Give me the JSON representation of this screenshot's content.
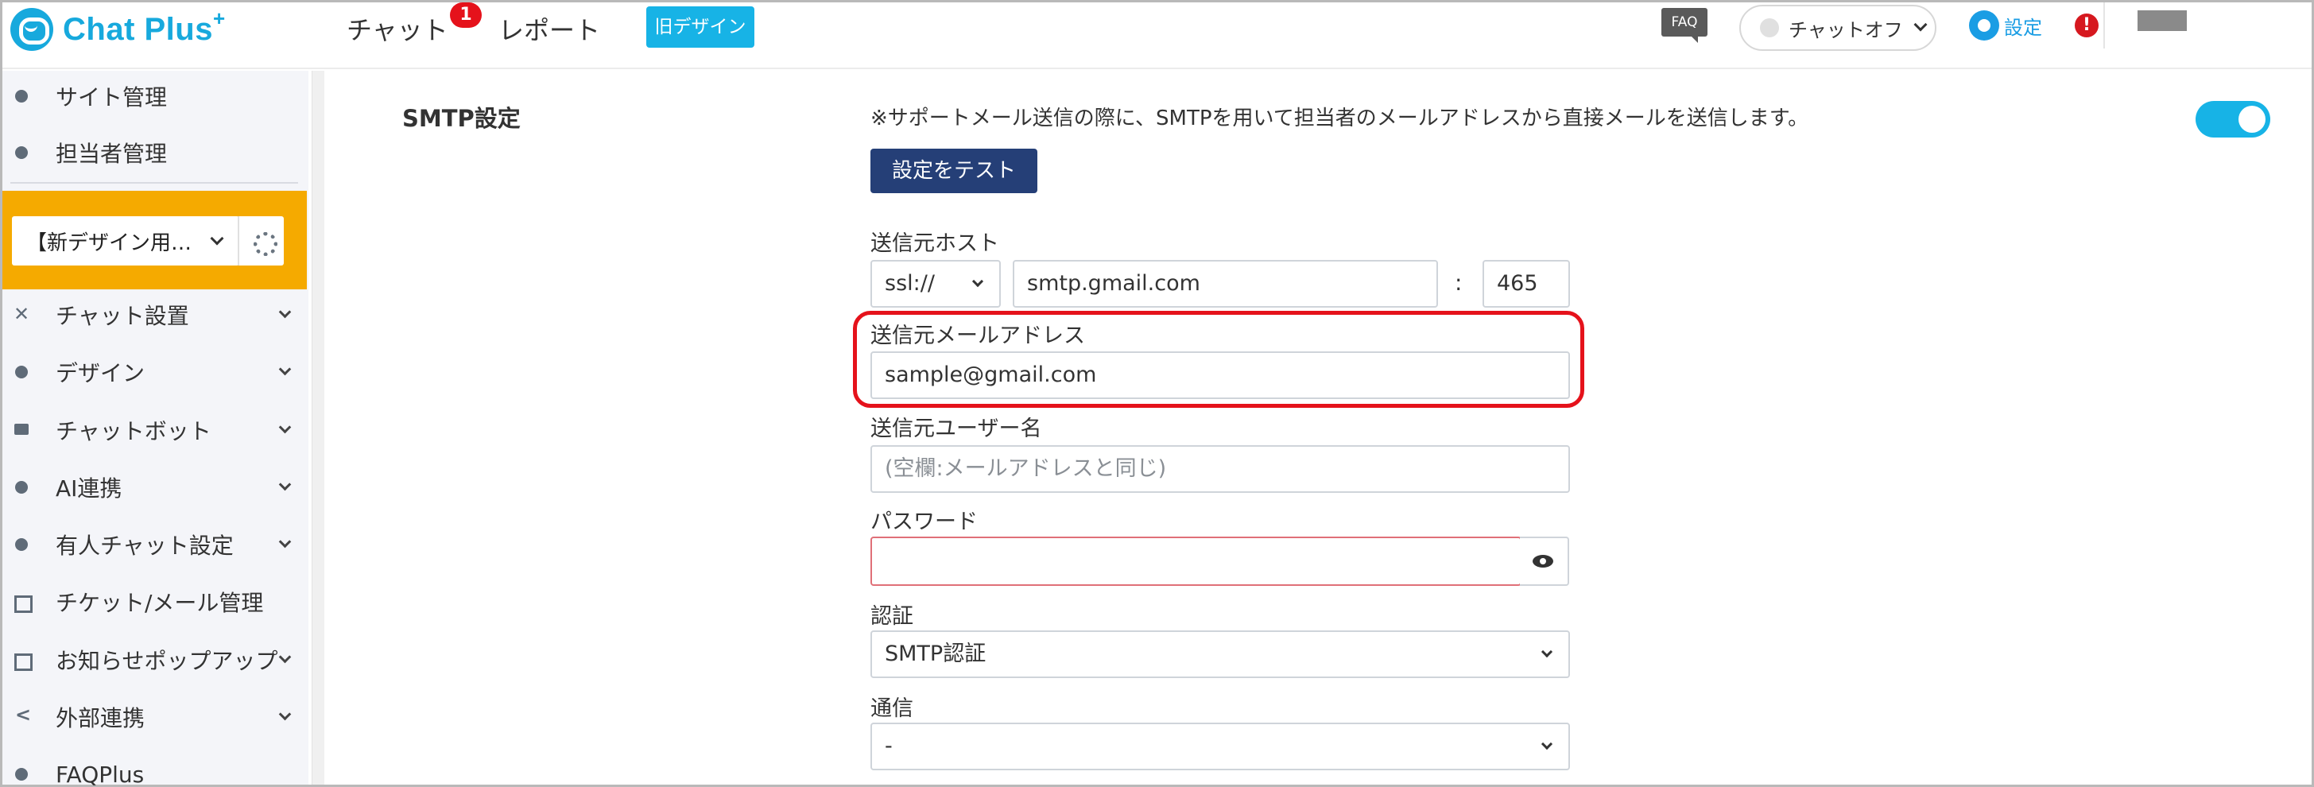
{
  "header": {
    "logo_text": "Chat Plus",
    "logo_sup": "+",
    "nav": [
      {
        "label": "チャット",
        "badge": "1"
      },
      {
        "label": "レポート"
      }
    ],
    "old_design_label": "旧デザイン",
    "faq_label": "FAQ",
    "chat_status_label": "チャットオフ",
    "settings_label": "設定",
    "alert_icon": "!"
  },
  "sidebar": {
    "items_top": [
      {
        "label": "サイト管理",
        "icon": "gear-icon"
      },
      {
        "label": "担当者管理",
        "icon": "users-icon"
      }
    ],
    "site_select_value": "【新デザイン用…",
    "items": [
      {
        "label": "チャット設置",
        "icon": "tools-icon",
        "chevron": true
      },
      {
        "label": "デザイン",
        "icon": "palette-icon",
        "chevron": true
      },
      {
        "label": "チャットボット",
        "icon": "chatbot-icon",
        "chevron": true
      },
      {
        "label": "AI連携",
        "icon": "lightbulb-icon",
        "chevron": true
      },
      {
        "label": "有人チャット設定",
        "icon": "headset-icon",
        "chevron": true
      },
      {
        "label": "チケット/メール管理",
        "icon": "ticket-icon",
        "chevron": false
      },
      {
        "label": "お知らせポップアップ",
        "icon": "popup-icon",
        "chevron": true
      },
      {
        "label": "外部連携",
        "icon": "share-icon",
        "chevron": true
      },
      {
        "label": "FAQPlus",
        "icon": "faqplus-icon",
        "chevron": false
      }
    ]
  },
  "main": {
    "section_title": "SMTP設定",
    "description": "※サポートメール送信の際に、SMTPを用いて担当者のメールアドレスから直接メールを送信します。",
    "test_button": "設定をテスト",
    "host": {
      "label": "送信元ホスト",
      "protocol": "ssl://",
      "host_value": "smtp.gmail.com",
      "colon": ":",
      "port_value": "465"
    },
    "email": {
      "label": "送信元メールアドレス",
      "value": "sample@gmail.com"
    },
    "username": {
      "label": "送信元ユーザー名",
      "placeholder": "(空欄:メールアドレスと同じ)"
    },
    "password": {
      "label": "パスワード",
      "value": ""
    },
    "auth": {
      "label": "認証",
      "value": "SMTP認証"
    },
    "comm": {
      "label": "通信",
      "value": "-"
    }
  },
  "colors": {
    "brand": "#17a9dd",
    "sidebar_highlight": "#f5aa00",
    "test_button": "#253f77",
    "toggle_on": "#17b3e6",
    "highlight_border": "#e5121b"
  }
}
